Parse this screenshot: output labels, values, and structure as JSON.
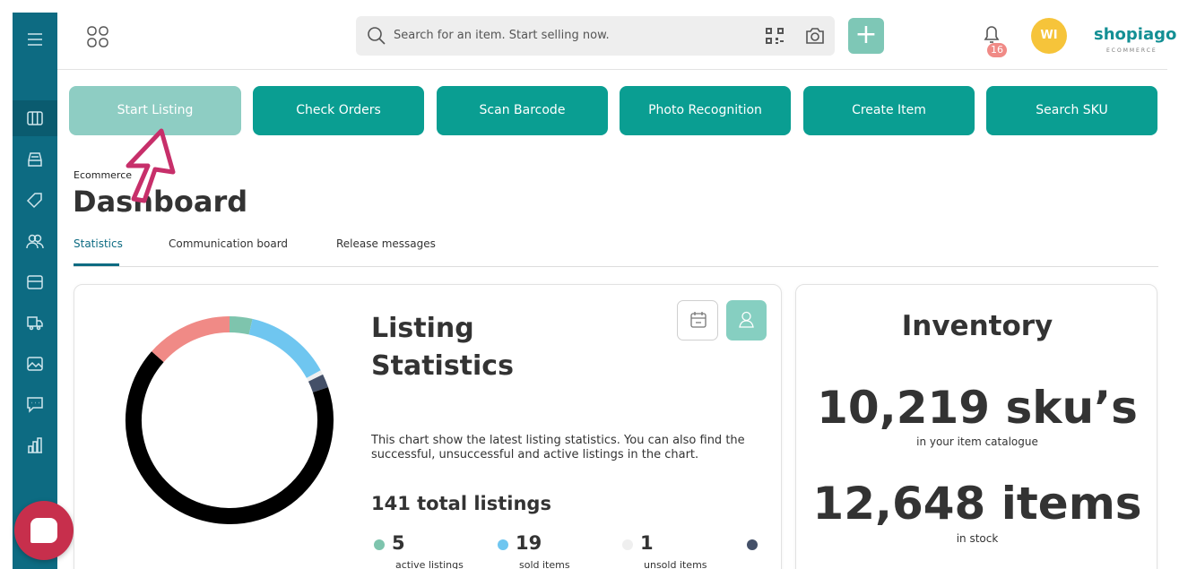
{
  "colors": {
    "sidebar": "#0d6b82",
    "accent": "#0a9e92",
    "accent_light": "#8ecdc3",
    "chat": "#c72f4c",
    "avatar": "#f6c43a",
    "badge": "#f08a86"
  },
  "sidebar": {
    "items": [
      {
        "icon": "menu-icon"
      },
      {
        "icon": "columns-icon"
      },
      {
        "icon": "inbox-icon"
      },
      {
        "icon": "tag-icon"
      },
      {
        "icon": "users-icon"
      },
      {
        "icon": "card-icon"
      },
      {
        "icon": "truck-icon"
      },
      {
        "icon": "image-icon"
      },
      {
        "icon": "comment-icon"
      },
      {
        "icon": "bar-chart-icon"
      }
    ]
  },
  "header": {
    "search_placeholder": "Search for an item. Start selling now.",
    "plus_label": "+",
    "notifications_count": "16",
    "avatar_initials": "WI",
    "logo_text": "shopiago",
    "logo_sub": "ECOMMERCE"
  },
  "actions": [
    "Start Listing",
    "Check Orders",
    "Scan Barcode",
    "Photo Recognition",
    "Create Item",
    "Search SKU"
  ],
  "page": {
    "breadcrumb": "Ecommerce",
    "title": "Dashboard",
    "tabs": [
      "Statistics",
      "Communication board",
      "Release messages"
    ]
  },
  "listing": {
    "title": "Listing Statistics",
    "description": "This chart show the latest listing statistics. You can also find the successful, unsuccessful and active listings in the chart.",
    "total": "141 total listings",
    "stats": [
      {
        "value": "5",
        "label": "active listings",
        "color": "#7ec4ad"
      },
      {
        "value": "19",
        "label": "sold items",
        "color": "#6fc6f0"
      },
      {
        "value": "1",
        "label": "unsold items",
        "color": "#efefef"
      },
      {
        "value": "",
        "label": "",
        "color": "#445068"
      }
    ]
  },
  "chart_data": {
    "type": "pie",
    "variant": "donut",
    "segments": [
      {
        "label": "active listings",
        "value": 5,
        "color": "#7ec4ad"
      },
      {
        "label": "sold items",
        "value": 19,
        "color": "#6fc6f0"
      },
      {
        "label": "unsold items",
        "value": 1,
        "color": "#efefef"
      },
      {
        "label": "",
        "value": 3,
        "color": "#445068"
      },
      {
        "label": "",
        "value": 94,
        "color": "#000000"
      },
      {
        "label": "",
        "value": 19,
        "color": "#f08a86"
      }
    ]
  },
  "inventory": {
    "title": "Inventory",
    "skus": "10,219 sku’s",
    "skus_caption": "in your item catalogue",
    "items": "12,648 items",
    "items_caption": "in stock"
  }
}
